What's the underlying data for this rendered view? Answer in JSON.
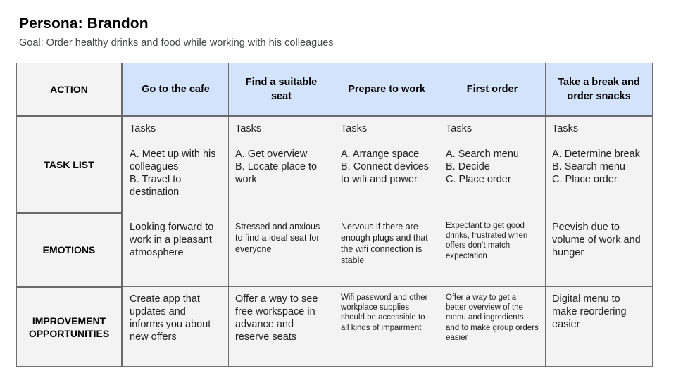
{
  "header": {
    "title": "Persona: Brandon",
    "goal": "Goal: Order healthy drinks and food while working with his colleagues"
  },
  "journey_map": {
    "colors": {
      "phase_header_bg": "#d3e3fb",
      "cell_bg": "#f3f3f3",
      "border": "#707070"
    },
    "row_labels": {
      "action": "ACTION",
      "task_list": "TASK LIST",
      "emotions": "EMOTIONS",
      "improvement": "IMPROVEMENT\nOPPORTUNITIES"
    },
    "phases": [
      {
        "action": "Go to the cafe",
        "tasks": "Tasks\n\nA. Meet up with his colleagues\nB. Travel to destination",
        "emotions": "Looking forward to work in a pleasant atmosphere",
        "improvement": "Create app that updates and informs you about new offers"
      },
      {
        "action": "Find a suitable seat",
        "tasks": "Tasks\n\nA. Get overview\nB. Locate place to work",
        "emotions": "Stressed and anxious to find a ideal seat for everyone",
        "improvement": "Offer a way to see free workspace in advance and reserve seats"
      },
      {
        "action": "Prepare to work",
        "tasks": "Tasks\n\nA. Arrange space\nB. Connect devices to wifi and power",
        "emotions": "Nervous if there are enough plugs and that the wifi connection is stable",
        "improvement": "Wifi password and other workplace supplies should be accessible to all kinds of impairment"
      },
      {
        "action": "First order",
        "tasks": "Tasks\n\nA. Search menu\nB. Decide\nC. Place order",
        "emotions": "Expectant to get good drinks, frustrated when offers don’t match expectation",
        "improvement": "Offer a way to get a better overview of the menu and ingredients and to make group orders easier"
      },
      {
        "action": "Take a break and order snacks",
        "tasks": "Tasks\n\nA. Determine break\nB. Search menu\nC. Place order",
        "emotions": "Peevish due to volume of work and hunger",
        "improvement": "Digital menu to make reordering easier"
      }
    ]
  }
}
